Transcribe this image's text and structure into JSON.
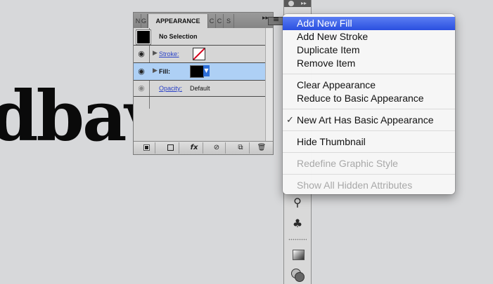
{
  "artwork": {
    "text": "dbav"
  },
  "panel": {
    "tabs": [
      "N",
      "G",
      "APPEARANCE",
      "C",
      "C",
      "S"
    ],
    "more_label": "▸▸",
    "rows": {
      "selection": {
        "label": "No Selection"
      },
      "stroke": {
        "label": "Stroke:"
      },
      "fill": {
        "label": "Fill:"
      },
      "opacity": {
        "label": "Opacity:",
        "value": "Default"
      }
    },
    "footer_buttons": [
      "add-stroke",
      "add-fill",
      "fx",
      "clear",
      "duplicate",
      "delete"
    ],
    "footer_fx_label": "fx"
  },
  "menu": {
    "items": [
      {
        "label": "Add New Fill",
        "state": "highlighted"
      },
      {
        "label": "Add New Stroke",
        "state": "normal"
      },
      {
        "label": "Duplicate Item",
        "state": "normal"
      },
      {
        "label": "Remove Item",
        "state": "normal"
      },
      {
        "label": "Clear Appearance",
        "state": "normal"
      },
      {
        "label": "Reduce to Basic Appearance",
        "state": "normal"
      },
      {
        "label": "New Art Has Basic Appearance",
        "state": "checked",
        "check": "✓"
      },
      {
        "label": "Hide Thumbnail",
        "state": "normal"
      },
      {
        "label": "Redefine Graphic Style",
        "state": "disabled"
      },
      {
        "label": "Show All Hidden Attributes",
        "state": "disabled"
      }
    ]
  },
  "colors": {
    "menu_highlight": "#3b63ea",
    "selected_row": "#aed0f5",
    "stroke_none": "#d4001a",
    "link_blue": "#2a42c8"
  },
  "icons": {
    "visibility": "eye-icon",
    "expand": "triangle-right-icon",
    "panel_menu": "panel-menu-icon"
  }
}
